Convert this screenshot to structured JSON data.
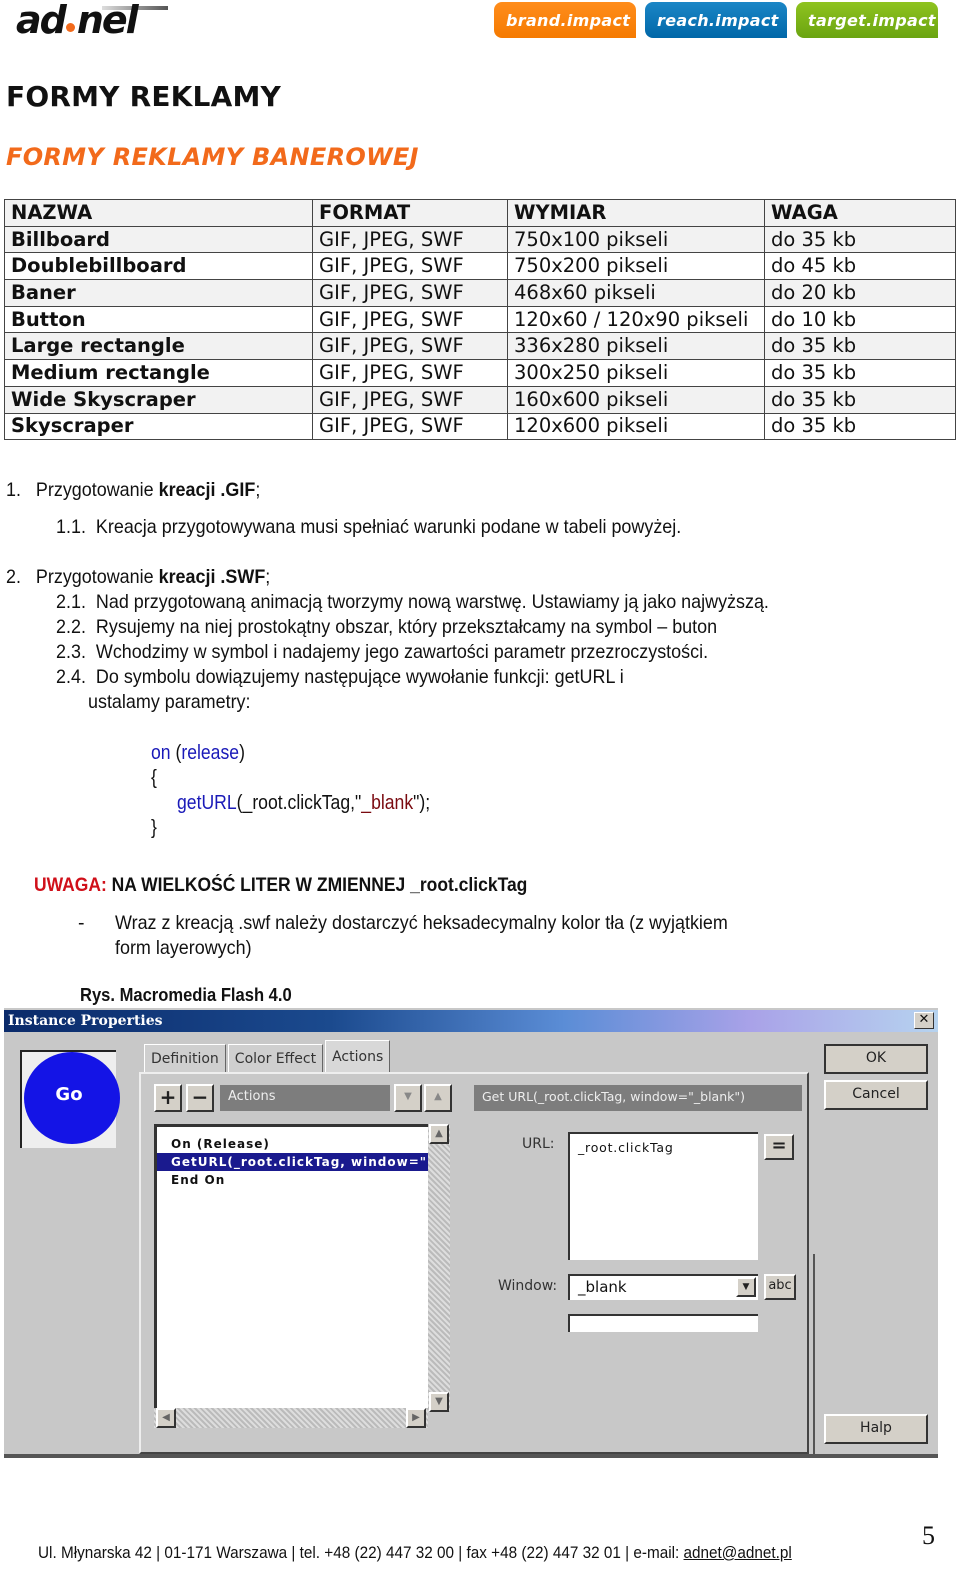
{
  "header": {
    "logo": {
      "part1": "ad",
      "part2": "nel",
      "dot_color": "#f26a1b"
    },
    "tabs": [
      {
        "label": "brand.impact",
        "color": "#f57a00"
      },
      {
        "label": "reach.impact",
        "color": "#0067a8"
      },
      {
        "label": "target.impact",
        "color": "#6aa411"
      }
    ]
  },
  "title": "FORMY REKLAMY",
  "subtitle": "FORMY REKLAMY BANEROWEJ",
  "table": {
    "headers": [
      "NAZWA",
      "FORMAT",
      "WYMIAR",
      "WAGA"
    ],
    "rows": [
      [
        "Billboard",
        "GIF, JPEG, SWF",
        "750x100 pikseli",
        "do 35 kb"
      ],
      [
        "Doublebillboard",
        "GIF, JPEG, SWF",
        "750x200 pikseli",
        "do 45 kb"
      ],
      [
        "Baner",
        "GIF, JPEG, SWF",
        "468x60 pikseli",
        "do 20 kb"
      ],
      [
        "Button",
        "GIF, JPEG, SWF",
        "120x60 / 120x90 pikseli",
        "do 10 kb"
      ],
      [
        "Large rectangle",
        "GIF, JPEG, SWF",
        "336x280 pikseli",
        "do 35 kb"
      ],
      [
        "Medium rectangle",
        "GIF, JPEG, SWF",
        "300x250 pikseli",
        "do 35 kb"
      ],
      [
        "Wide Skyscraper",
        "GIF, JPEG, SWF",
        "160x600 pikseli",
        "do 35 kb"
      ],
      [
        "Skyscraper",
        "GIF, JPEG, SWF",
        "120x600 pikseli",
        "do 35 kb"
      ]
    ]
  },
  "instructions": {
    "s1": {
      "num": "1.",
      "pre": "Przygotowanie ",
      "bold": "kreacji .GIF",
      "post": ";"
    },
    "s1_1": {
      "num": "1.1.",
      "text": "Kreacja przygotowywana musi spełniać warunki podane w tabeli powyżej."
    },
    "s2": {
      "num": "2.",
      "pre": "Przygotowanie ",
      "bold": "kreacji .SWF",
      "post": ";"
    },
    "s2_1": {
      "num": "2.1.",
      "text": "Nad przygotowaną animacją tworzymy nową warstwę. Ustawiamy ją jako najwyższą."
    },
    "s2_2": {
      "num": "2.2.",
      "text": "Rysujemy na niej prostokątny obszar, który przekształcamy na symbol – buton"
    },
    "s2_3": {
      "num": "2.3.",
      "text": "Wchodzimy w symbol i nadajemy jego zawartości parametr przezroczystości."
    },
    "s2_4": {
      "num": "2.4.",
      "text": "Do symbolu dowiązujemy następujące wywołanie funkcji: getURL i",
      "cont": "ustalamy parametry:"
    }
  },
  "code": {
    "line1_kw": "on",
    "line1_open": " (",
    "line1_arg": "release",
    "line1_close": ")",
    "line2": "{",
    "line3_fn": "getURL",
    "line3_args": "(_root.clickTag,\"",
    "line3_str": "_blank",
    "line3_end": "\");",
    "line4": "}"
  },
  "warning": {
    "label": "UWAGA:",
    "text": " NA WIELKOŚĆ LITER W ZMIENNEJ _root.clickTag"
  },
  "note": {
    "bullet": "-",
    "line1": "Wraz z kreacją .swf należy dostarczyć heksadecymalny kolor tła (z wyjątkiem",
    "line2": "form layerowych)"
  },
  "figure_caption": "Rys. Macromedia Flash 4.0",
  "dialog": {
    "title": "Instance Properties",
    "close_glyph": "✕",
    "preview_label": "Go",
    "tabs": [
      "Definition",
      "Color Effect",
      "Actions"
    ],
    "active_tab": "Actions",
    "add_glyph": "+",
    "remove_glyph": "−",
    "actions_label": "Actions",
    "move_down_glyph": "▼",
    "move_up_glyph": "▲",
    "summary": "Get URL(_root.clickTag, window=\"_blank\")",
    "list_items": [
      "On (Release)",
      "GetURL(_root.clickTag, window=\"",
      "End On"
    ],
    "selected_index": 1,
    "url_label": "URL:",
    "url_value": "_root.clickTag",
    "url_expr_glyph": "=",
    "window_label": "Window:",
    "window_value": "_blank",
    "window_abc": "abc",
    "ok": "OK",
    "cancel": "Cancel",
    "help": "Halp",
    "scroll_left": "◀",
    "scroll_right": "▶",
    "scroll_up": "▲",
    "scroll_down": "▼"
  },
  "footer": {
    "address": "Ul. Młynarska 42 | 01-171 Warszawa | tel. +48 (22) 447 32 00 | fax +48 (22) 447 32 01 | e-mail: ",
    "email": "adnet@adnet.pl",
    "page_number": "5"
  }
}
